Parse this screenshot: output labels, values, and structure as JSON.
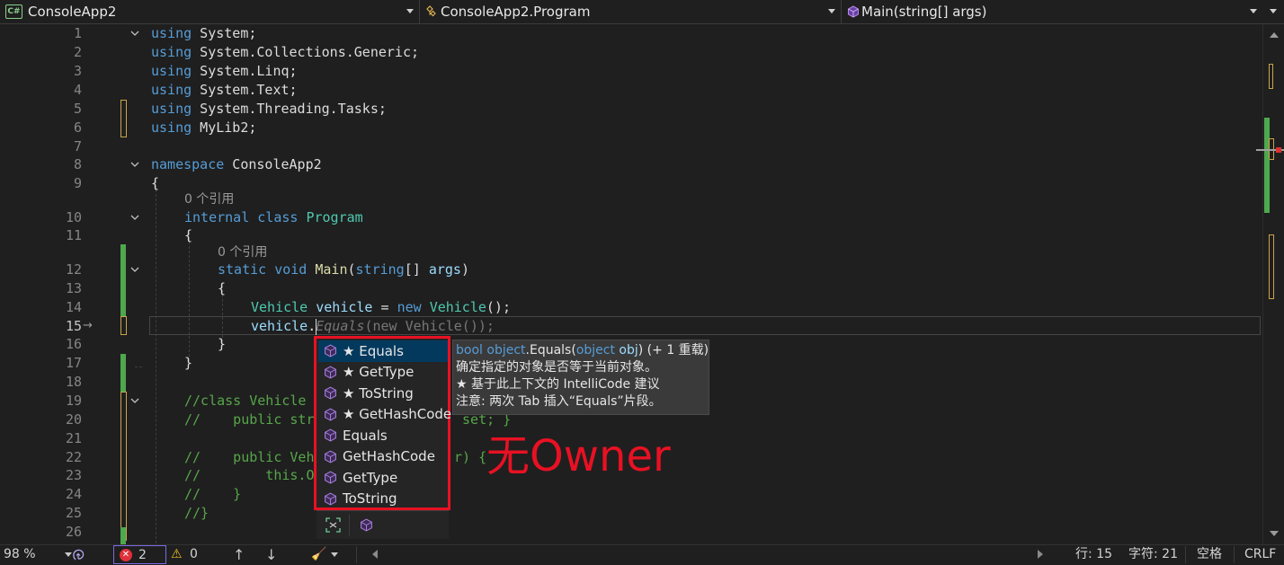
{
  "navbar": {
    "project_badge": "C#",
    "project": "ConsoleApp2",
    "class_name": "ConsoleApp2.Program",
    "member": "Main(string[] args)"
  },
  "editor": {
    "line_numbers": [
      "1",
      "2",
      "3",
      "4",
      "5",
      "6",
      "7",
      "8",
      "9",
      "10",
      "11",
      "12",
      "13",
      "14",
      "15",
      "16",
      "17",
      "18",
      "19",
      "20",
      "21",
      "22",
      "23",
      "24",
      "25",
      "26"
    ],
    "current_line": "15",
    "code_lens_class": "0 个引用",
    "code_lens_main": "0 个引用",
    "lines": {
      "l1": [
        "using",
        " System;"
      ],
      "l2": [
        "using",
        " System.Collections.Generic;"
      ],
      "l3": [
        "using",
        " System.Linq;"
      ],
      "l4": [
        "using",
        " System.Text;"
      ],
      "l5": [
        "using",
        " System.Threading.Tasks;"
      ],
      "l6": [
        "using",
        " MyLib2;"
      ],
      "l8": [
        "namespace",
        " ConsoleApp2"
      ],
      "l9": "{",
      "l10": [
        "internal",
        " ",
        "class",
        " ",
        "Program"
      ],
      "l11": "{",
      "l12": [
        "static",
        " ",
        "void",
        " ",
        "Main",
        "(",
        "string",
        "[] ",
        "args",
        ")"
      ],
      "l13": "{",
      "l14": [
        "Vehicle",
        " ",
        "vehicle",
        " = ",
        "new",
        " ",
        "Vehicle",
        "();"
      ],
      "l15": [
        "vehicle",
        ".",
        "Equals",
        "(new Vehicle());"
      ],
      "l16": "}",
      "l17": "}",
      "l19": "//class Vehicle",
      "l20": "//    public str",
      "l20b": " set; }",
      "l22": "//    public Veh",
      "l22b": "r) {",
      "l23": "//        this.O",
      "l24": "//    }",
      "l25": "//}"
    }
  },
  "completion": {
    "items": [
      {
        "label": "★ Equals",
        "selected": true
      },
      {
        "label": "★ GetType"
      },
      {
        "label": "★ ToString"
      },
      {
        "label": "★ GetHashCode"
      },
      {
        "label": "Equals"
      },
      {
        "label": "GetHashCode"
      },
      {
        "label": "GetType"
      },
      {
        "label": "ToString"
      }
    ]
  },
  "tooltip": {
    "sig_kw": "bool",
    "sig_obj": "object",
    "sig_method": ".Equals(",
    "sig_param_type": "object",
    "sig_param": "obj",
    "sig_overloads": ") (+ 1 重载)",
    "line2": "确定指定的对象是否等于当前对象。",
    "line3": "★  基于此上下文的 IntelliCode 建议",
    "line4": "注意: 两次 Tab 插入“Equals”片段。"
  },
  "annotation": "无Owner",
  "status": {
    "zoom": "98 %",
    "errors": "2",
    "warnings": "0",
    "line": "行: 15",
    "char": "字符: 21",
    "spaces": "空格",
    "eol": "CRLF"
  },
  "colors": {
    "keyword": "#569cd6",
    "type": "#4ec9b0",
    "method": "#dcdcaa",
    "variable": "#9cdcfe",
    "comment": "#57a64a",
    "annotation_red": "#e81123",
    "change_green": "#4ea84e",
    "change_yellow": "#c9a54a"
  }
}
